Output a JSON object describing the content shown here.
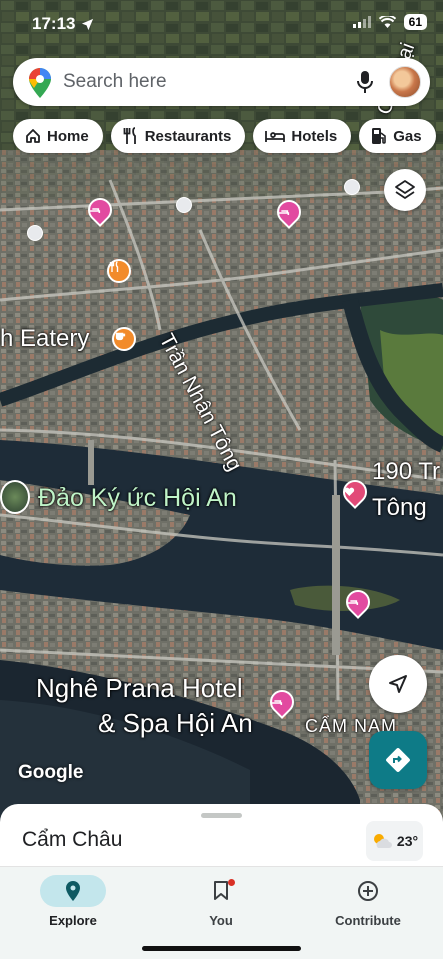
{
  "status_bar": {
    "time": "17:13",
    "battery": "61"
  },
  "search": {
    "placeholder": "Search here"
  },
  "chips": [
    {
      "label": "Home",
      "icon": "home-icon"
    },
    {
      "label": "Restaurants",
      "icon": "restaurant-icon"
    },
    {
      "label": "Hotels",
      "icon": "hotel-icon"
    },
    {
      "label": "Gas",
      "icon": "gas-icon"
    }
  ],
  "map_labels": {
    "street": "Trần Nhân Tông",
    "eatery": "h Eatery",
    "island": "Đảo Ký ức Hội An",
    "place_190_line1": "190 Tr",
    "place_190_line2": "Tông",
    "hotel_line1": "Nghê Prana Hotel",
    "hotel_line2": "& Spa Hội An",
    "cam_nam": "CẨM NAM",
    "top_right_partial": "Cửa Đại"
  },
  "google_logo": "Google",
  "sheet": {
    "title": "Cẩm Châu",
    "temperature": "23°"
  },
  "nav": [
    {
      "label": "Explore",
      "icon": "explore-pin-icon",
      "active": true
    },
    {
      "label": "You",
      "icon": "bookmark-icon",
      "active": false,
      "badge": true
    },
    {
      "label": "Contribute",
      "icon": "add-circle-icon",
      "active": false
    }
  ],
  "colors": {
    "accent": "#0e7b87",
    "hotel_pin": "#e24aa0",
    "food_pin": "#f28b2b",
    "active_pill": "#c3e6ec"
  }
}
